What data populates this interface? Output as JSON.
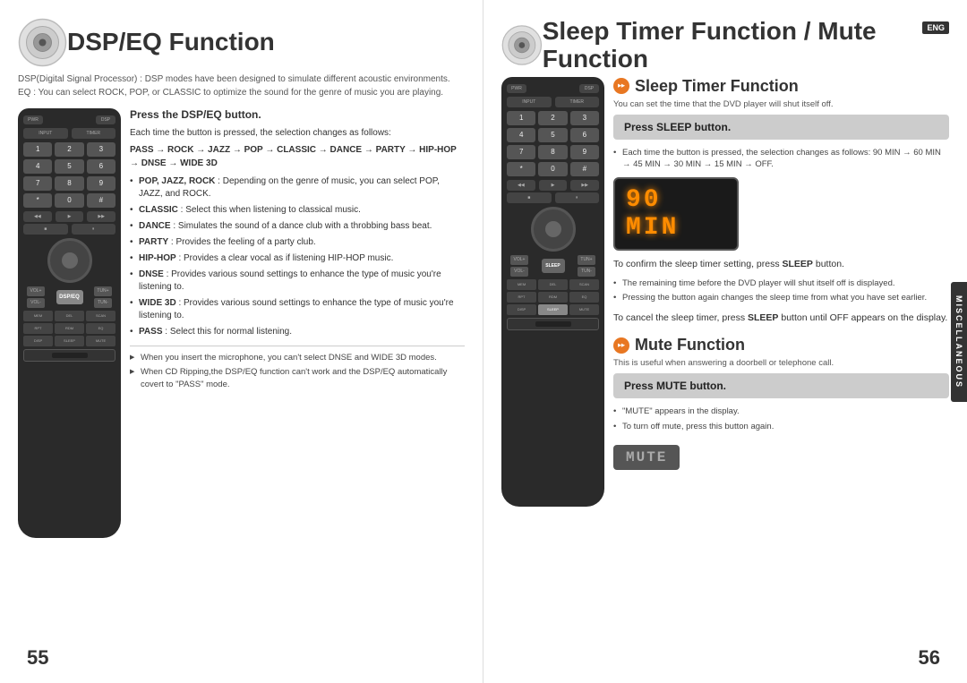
{
  "left_page": {
    "page_number": "55",
    "title": "DSP/EQ Function",
    "subtitle_line1": "DSP(Digital Signal Processor) : DSP modes have been designed to simulate different acoustic environments.",
    "subtitle_line2": "EQ : You can select ROCK, POP, or CLASSIC to optimize the sound for the genre of music you are playing.",
    "instruction_title": "Press the DSP/EQ button.",
    "instruction_desc": "Each time the button is pressed, the selection changes as follows:",
    "chain": "PASS → ROCK → JAZZ → POP → CLASSIC → DANCE → PARTY → HIP-HOP → DNSE → WIDE 3D",
    "bullets": [
      {
        "bold": "POP, JAZZ, ROCK",
        "text": ": Depending on the genre of music, you can select POP, JAZZ, and ROCK."
      },
      {
        "bold": "CLASSIC",
        "text": ": Select this when listening to classical music."
      },
      {
        "bold": "DANCE",
        "text": ": Simulates the sound of a dance club with a throbbing bass beat."
      },
      {
        "bold": "PARTY",
        "text": ": Provides the feeling of a party club."
      },
      {
        "bold": "HIP-HOP",
        "text": ": Provides a clear vocal as if listening HIP-HOP music."
      },
      {
        "bold": "DNSE",
        "text": ": Provides various sound settings to enhance the type of music you're listening to."
      },
      {
        "bold": "WIDE 3D",
        "text": ": Provides various sound settings to enhance the type of music you're listening to."
      },
      {
        "bold": "PASS",
        "text": ": Select this for normal listening."
      }
    ],
    "notes": [
      "When you insert the microphone, you can't select DNSE and WIDE 3D modes.",
      "When CD Ripping,the DSP/EQ function can't work and the DSP/EQ automatically covert to \"PASS\" mode."
    ]
  },
  "right_page": {
    "page_number": "56",
    "title": "Sleep Timer Function / Mute Function",
    "eng_badge": "ENG",
    "sleep_section": {
      "title": "Sleep Timer Function",
      "desc": "You can set the time that the DVD player will shut itself off.",
      "press_box": "Press SLEEP button.",
      "press_box_bold": "SLEEP",
      "display_value": "90 MIN",
      "display_segments": "90 MIN",
      "bullets": [
        "Each time the button is pressed, the selection changes as follows: 90 MIN → 60 MIN → 45 MIN → 30 MIN → 15 MIN → OFF."
      ],
      "confirm_text": "To confirm the sleep timer setting, press SLEEP button.",
      "confirm_bold": "SLEEP",
      "note_bullets": [
        "The remaining time before the DVD player will shut itself off is displayed.",
        "Pressing the button again changes the sleep time from what you have set earlier."
      ],
      "cancel_text": "To cancel the sleep timer, press SLEEP button until OFF appears on the display.",
      "cancel_bold": "SLEEP"
    },
    "mute_section": {
      "title": "Mute Function",
      "desc": "This is useful when answering a doorbell or telephone call.",
      "press_box": "Press MUTE button.",
      "press_box_bold": "MUTE",
      "bullets": [
        "\"MUTE\" appears in the display.",
        "To turn off mute, press this button again."
      ],
      "display_value": "MUTE"
    },
    "misc_label": "MISCELLANEOUS"
  },
  "remote_buttons": {
    "row1": [
      "POWER",
      "DSP/EQ"
    ],
    "row2": [
      "1",
      "2",
      "3"
    ],
    "row3": [
      "4",
      "5",
      "6"
    ],
    "row4": [
      "7",
      "8",
      "9"
    ],
    "row5": [
      "",
      "0",
      ""
    ],
    "dsp_label": "DSP/EQ",
    "vol_label": "VOL",
    "tune_label": "TUNE"
  }
}
